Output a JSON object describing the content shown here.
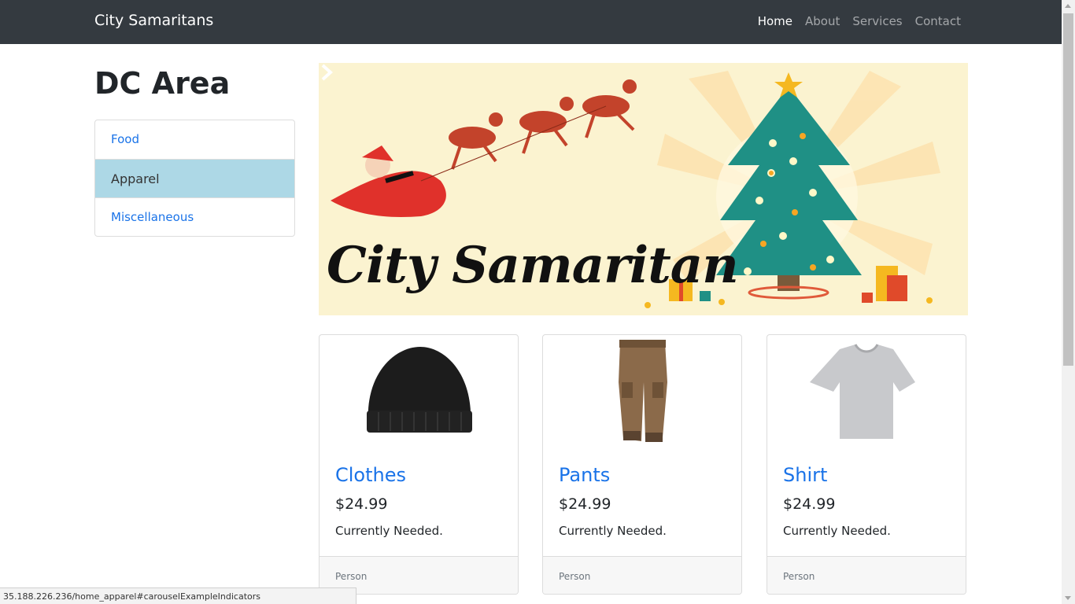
{
  "navbar": {
    "brand": "City Samaritans",
    "items": [
      {
        "label": "Home",
        "active": true
      },
      {
        "label": "About",
        "active": false
      },
      {
        "label": "Services",
        "active": false
      },
      {
        "label": "Contact",
        "active": false
      }
    ]
  },
  "sidebar": {
    "title": "DC Area",
    "items": [
      {
        "label": "Food",
        "active": false
      },
      {
        "label": "Apparel",
        "active": true
      },
      {
        "label": "Miscellaneous",
        "active": false
      }
    ]
  },
  "carousel": {
    "logo_text": "City Samaritan",
    "slide_count": 3,
    "active_slide": 1
  },
  "products": [
    {
      "title": "Clothes",
      "price": "$24.99",
      "status": "Currently Needed.",
      "footer": "Person",
      "image_icon": "beanie-hat-icon"
    },
    {
      "title": "Pants",
      "price": "$24.99",
      "status": "Currently Needed.",
      "footer": "Person",
      "image_icon": "cargo-pants-icon"
    },
    {
      "title": "Shirt",
      "price": "$24.99",
      "status": "Currently Needed.",
      "footer": "Person",
      "image_icon": "tshirt-icon"
    }
  ],
  "status_bar": {
    "url": "35.188.226.236/home_apparel#carouselExampleIndicators"
  },
  "colors": {
    "navbar_bg": "#343a40",
    "link": "#1a73e8",
    "active_list_bg": "#add8e6",
    "carousel_bg": "#fbf3d0"
  }
}
